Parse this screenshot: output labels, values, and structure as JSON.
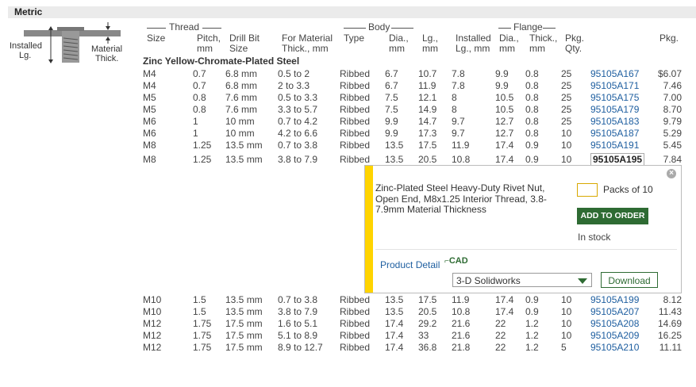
{
  "section_title": "Metric",
  "diagram": {
    "installed_label_1": "Installed",
    "installed_label_2": "Lg.",
    "material_label_1": "Material",
    "material_label_2": "Thick."
  },
  "groups": {
    "thread": "Thread",
    "body": "Body",
    "flange": "Flange"
  },
  "columns": {
    "size": [
      "",
      "Size"
    ],
    "pitch": [
      "Pitch,",
      "mm"
    ],
    "drill": [
      "Drill Bit",
      "Size"
    ],
    "material": [
      "For Material",
      "Thick., mm"
    ],
    "type": [
      "",
      "Type"
    ],
    "dia": [
      "Dia.,",
      "mm"
    ],
    "lg": [
      "Lg.,",
      "mm"
    ],
    "installed": [
      "Installed",
      "Lg., mm"
    ],
    "fdia": [
      "Dia.,",
      "mm"
    ],
    "thick": [
      "Thick.,",
      "mm"
    ],
    "pkgqty": [
      "Pkg.",
      "Qty."
    ],
    "pkg": [
      "",
      "Pkg."
    ]
  },
  "group_name": "Zinc Yellow-Chromate-Plated Steel",
  "rows_top": [
    {
      "size": "M4",
      "pitch": "0.7",
      "drill": "6.8 mm",
      "mat": "0.5 to 2",
      "type": "Ribbed",
      "dia": "6.7",
      "lg": "10.7",
      "inst": "7.8",
      "fdia": "9.9",
      "fth": "0.8",
      "qty": "25",
      "pn": "95105A167",
      "price": "$6.07"
    },
    {
      "size": "M4",
      "pitch": "0.7",
      "drill": "6.8 mm",
      "mat": "2 to 3.3",
      "type": "Ribbed",
      "dia": "6.7",
      "lg": "11.9",
      "inst": "7.8",
      "fdia": "9.9",
      "fth": "0.8",
      "qty": "25",
      "pn": "95105A171",
      "price": "7.46"
    },
    {
      "size": "M5",
      "pitch": "0.8",
      "drill": "7.6 mm",
      "mat": "0.5 to 3.3",
      "type": "Ribbed",
      "dia": "7.5",
      "lg": "12.1",
      "inst": "8",
      "fdia": "10.5",
      "fth": "0.8",
      "qty": "25",
      "pn": "95105A175",
      "price": "7.00"
    },
    {
      "size": "M5",
      "pitch": "0.8",
      "drill": "7.6 mm",
      "mat": "3.3 to 5.7",
      "type": "Ribbed",
      "dia": "7.5",
      "lg": "14.9",
      "inst": "8",
      "fdia": "10.5",
      "fth": "0.8",
      "qty": "25",
      "pn": "95105A179",
      "price": "8.70"
    },
    {
      "size": "M6",
      "pitch": "1",
      "drill": "10 mm",
      "mat": "0.7 to 4.2",
      "type": "Ribbed",
      "dia": "9.9",
      "lg": "14.7",
      "inst": "9.7",
      "fdia": "12.7",
      "fth": "0.8",
      "qty": "25",
      "pn": "95105A183",
      "price": "9.79"
    },
    {
      "size": "M6",
      "pitch": "1",
      "drill": "10 mm",
      "mat": "4.2 to 6.6",
      "type": "Ribbed",
      "dia": "9.9",
      "lg": "17.3",
      "inst": "9.7",
      "fdia": "12.7",
      "fth": "0.8",
      "qty": "10",
      "pn": "95105A187",
      "price": "5.29"
    },
    {
      "size": "M8",
      "pitch": "1.25",
      "drill": "13.5 mm",
      "mat": "0.7 to 3.8",
      "type": "Ribbed",
      "dia": "13.5",
      "lg": "17.5",
      "inst": "11.9",
      "fdia": "17.4",
      "fth": "0.9",
      "qty": "10",
      "pn": "95105A191",
      "price": "5.45"
    }
  ],
  "selected_row": {
    "size": "M8",
    "pitch": "1.25",
    "drill": "13.5 mm",
    "mat": "3.8 to 7.9",
    "type": "Ribbed",
    "dia": "13.5",
    "lg": "20.5",
    "inst": "10.8",
    "fdia": "17.4",
    "fth": "0.9",
    "qty": "10",
    "pn": "95105A195",
    "price": "7.84"
  },
  "rows_bottom": [
    {
      "size": "M10",
      "pitch": "1.5",
      "drill": "13.5 mm",
      "mat": "0.7 to 3.8",
      "type": "Ribbed",
      "dia": "13.5",
      "lg": "17.5",
      "inst": "11.9",
      "fdia": "17.4",
      "fth": "0.9",
      "qty": "10",
      "pn": "95105A199",
      "price": "8.12"
    },
    {
      "size": "M10",
      "pitch": "1.5",
      "drill": "13.5 mm",
      "mat": "3.8 to 7.9",
      "type": "Ribbed",
      "dia": "13.5",
      "lg": "20.5",
      "inst": "10.8",
      "fdia": "17.4",
      "fth": "0.9",
      "qty": "10",
      "pn": "95105A207",
      "price": "11.43"
    },
    {
      "size": "M12",
      "pitch": "1.75",
      "drill": "17.5 mm",
      "mat": "1.6 to 5.1",
      "type": "Ribbed",
      "dia": "17.4",
      "lg": "29.2",
      "inst": "21.6",
      "fdia": "22",
      "fth": "1.2",
      "qty": "10",
      "pn": "95105A208",
      "price": "14.69"
    },
    {
      "size": "M12",
      "pitch": "1.75",
      "drill": "17.5 mm",
      "mat": "5.1 to 8.9",
      "type": "Ribbed",
      "dia": "17.4",
      "lg": "33",
      "inst": "21.6",
      "fdia": "22",
      "fth": "1.2",
      "qty": "10",
      "pn": "95105A209",
      "price": "16.25"
    },
    {
      "size": "M12",
      "pitch": "1.75",
      "drill": "17.5 mm",
      "mat": "8.9 to 12.7",
      "type": "Ribbed",
      "dia": "17.4",
      "lg": "36.8",
      "inst": "21.8",
      "fdia": "22",
      "fth": "1.2",
      "qty": "5",
      "pn": "95105A210",
      "price": "11.11"
    }
  ],
  "popup": {
    "description": "Zinc-Plated Steel Heavy-Duty Rivet Nut, Open End, M8x1.25 Interior Thread, 3.8-7.9mm Material Thickness",
    "quantity_value": "",
    "packs_label": "Packs of 10",
    "add_to_order": "ADD TO ORDER",
    "stock_status": "In stock",
    "product_detail": "Product Detail",
    "cad_label": "CAD",
    "cad_format": "3-D Solidworks",
    "download": "Download",
    "close_glyph": "×"
  },
  "colors": {
    "accent_yellow": "#ffd400",
    "order_green": "#2e6b33",
    "link_blue": "#1f5fa0"
  }
}
